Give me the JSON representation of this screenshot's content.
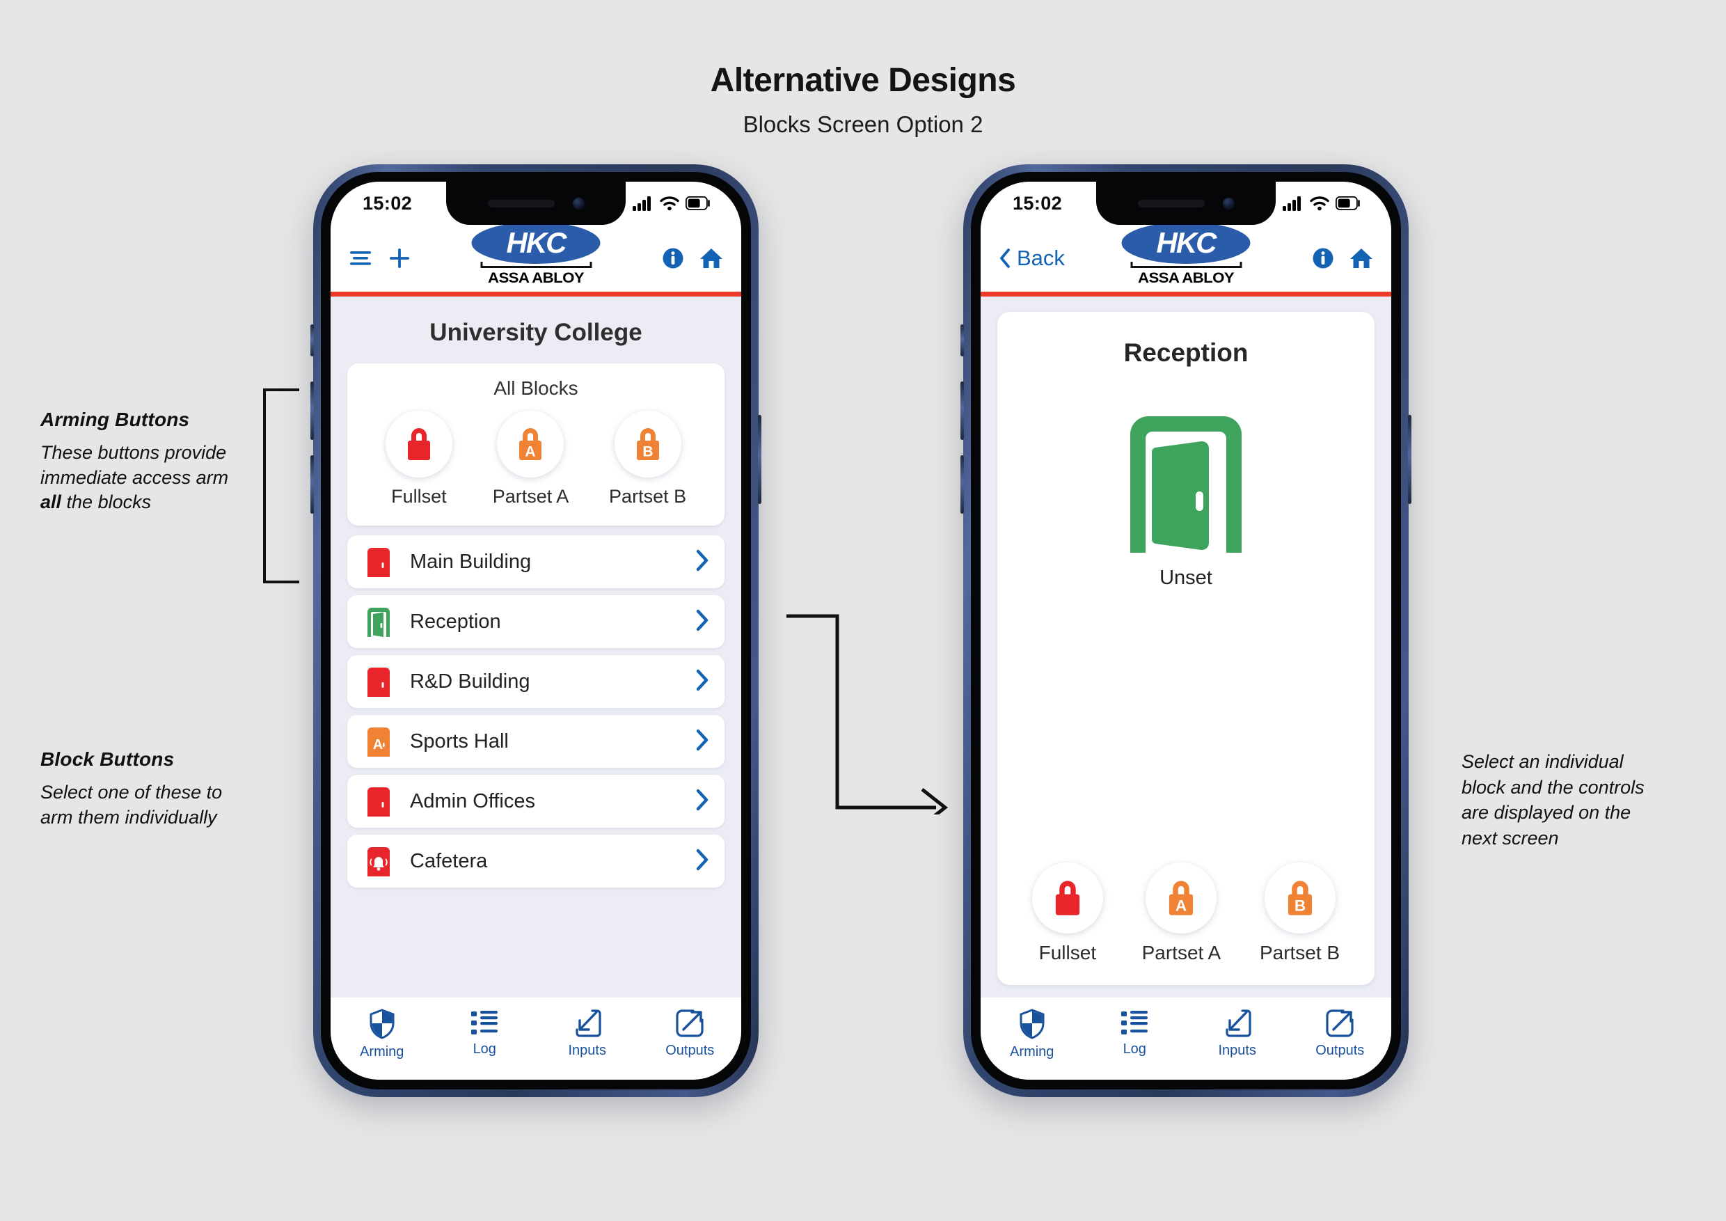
{
  "page": {
    "title": "Alternative Designs",
    "subtitle": "Blocks Screen Option 2"
  },
  "annotations": {
    "arming": {
      "title": "Arming Buttons",
      "body_before": "These buttons provide immediate access arm ",
      "body_strong": "all",
      "body_after": " the blocks"
    },
    "block": {
      "title": "Block Buttons",
      "body": "Select one of these to arm them individually"
    },
    "right": {
      "body": "Select an individual block and the controls are displayed on the next screen"
    }
  },
  "phone_list": {
    "status": {
      "time": "15:02",
      "signal": "signal-bars",
      "wifi": "wifi-icon",
      "battery": "battery-icon"
    },
    "header": {
      "menu_icon": "hamburger-menu-icon",
      "add_icon": "plus-icon",
      "info_icon": "info-icon",
      "home_icon": "home-icon",
      "logo_text": "HKC",
      "logo_sub": "ASSA ABLOY"
    },
    "site_title": "University College",
    "all_blocks": {
      "label": "All Blocks",
      "buttons": [
        {
          "label": "Fullset",
          "icon": "padlock-icon",
          "badge": "",
          "color": "#e8252a"
        },
        {
          "label": "Partset A",
          "icon": "padlock-a-icon",
          "badge": "A",
          "color": "#ef8234"
        },
        {
          "label": "Partset B",
          "icon": "padlock-b-icon",
          "badge": "B",
          "color": "#ef8234"
        }
      ]
    },
    "blocks": [
      {
        "name": "Main Building",
        "state": "set",
        "icon": "door-closed-icon",
        "badge": "",
        "color": "#e8252a"
      },
      {
        "name": "Reception",
        "state": "unset",
        "icon": "door-open-icon",
        "badge": "",
        "color": "#3da35d"
      },
      {
        "name": "R&D Building",
        "state": "set",
        "icon": "door-closed-icon",
        "badge": "",
        "color": "#e8252a"
      },
      {
        "name": "Sports Hall",
        "state": "partset",
        "icon": "door-partset-icon",
        "badge": "A",
        "color": "#ef8234"
      },
      {
        "name": "Admin Offices",
        "state": "set",
        "icon": "door-closed-icon",
        "badge": "",
        "color": "#e8252a"
      },
      {
        "name": "Cafetera",
        "state": "alarm",
        "icon": "door-alarm-icon",
        "badge": "",
        "color": "#e8252a"
      }
    ],
    "tabs": [
      {
        "label": "Arming",
        "icon": "shield-icon"
      },
      {
        "label": "Log",
        "icon": "list-icon"
      },
      {
        "label": "Inputs",
        "icon": "arrow-in-box-icon"
      },
      {
        "label": "Outputs",
        "icon": "arrow-out-box-icon"
      }
    ]
  },
  "phone_detail": {
    "status": {
      "time": "15:02",
      "signal": "signal-bars",
      "wifi": "wifi-icon",
      "battery": "battery-icon"
    },
    "header": {
      "back_label": "Back",
      "back_icon": "chevron-left-icon",
      "info_icon": "info-icon",
      "home_icon": "home-icon",
      "logo_text": "HKC",
      "logo_sub": "ASSA ABLOY"
    },
    "block_title": "Reception",
    "block_state": "Unset",
    "state_icon": "door-open-icon",
    "state_color": "#3da35d",
    "buttons": [
      {
        "label": "Fullset",
        "icon": "padlock-icon",
        "badge": "",
        "color": "#e8252a"
      },
      {
        "label": "Partset A",
        "icon": "padlock-a-icon",
        "badge": "A",
        "color": "#ef8234"
      },
      {
        "label": "Partset B",
        "icon": "padlock-b-icon",
        "badge": "B",
        "color": "#ef8234"
      }
    ],
    "tabs": [
      {
        "label": "Arming",
        "icon": "shield-icon"
      },
      {
        "label": "Log",
        "icon": "list-icon"
      },
      {
        "label": "Inputs",
        "icon": "arrow-in-box-icon"
      },
      {
        "label": "Outputs",
        "icon": "arrow-out-box-icon"
      }
    ]
  }
}
